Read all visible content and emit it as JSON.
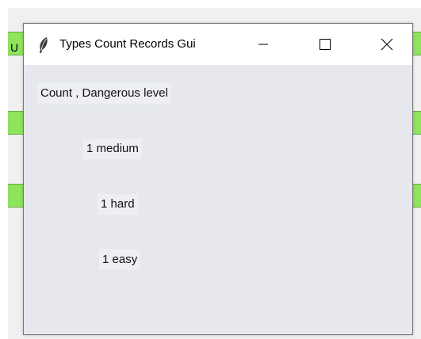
{
  "background_app": {
    "partial_label": "U"
  },
  "window": {
    "title": "Types Count Records Gui",
    "icon": "feather-icon",
    "controls": {
      "minimize": "minimize-icon",
      "maximize": "maximize-icon",
      "close": "close-icon"
    }
  },
  "content": {
    "header": "Count , Dangerous level",
    "rows": [
      "1 medium",
      "1 hard",
      "1 easy"
    ]
  },
  "colors": {
    "window_bg": "#e6e8ee",
    "titlebar_bg": "#ffffff",
    "background_green": "#8ee45c"
  }
}
